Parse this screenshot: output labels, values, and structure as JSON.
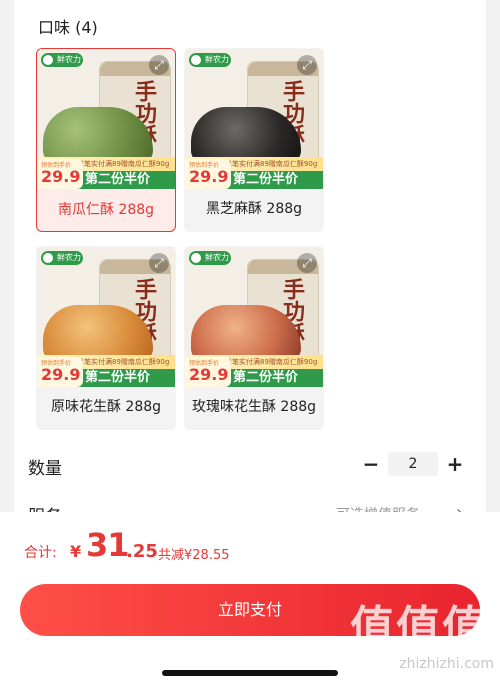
{
  "flavor": {
    "title": "口味 (4)",
    "items": [
      {
        "label": "南瓜仁酥 288g",
        "selected": true,
        "can_text": "手功酥",
        "price": "29.9",
        "price_cap": "预估到手价",
        "promo_top": "单笔实付满89赠南瓜仁酥90g",
        "promo": "第二份半价",
        "logo": "鲜农力"
      },
      {
        "label": "黑芝麻酥 288g",
        "selected": false,
        "can_text": "手功酥",
        "price": "29.9",
        "price_cap": "预估到手价",
        "promo_top": "单笔实付满89赠南瓜仁酥90g",
        "promo": "第二份半价",
        "logo": "鲜农力"
      },
      {
        "label": "原味花生酥 288g",
        "selected": false,
        "can_text": "手功酥",
        "price": "29.9",
        "price_cap": "预估到手价",
        "promo_top": "单笔实付满89赠南瓜仁酥90g",
        "promo": "第二份半价",
        "logo": "鲜农力"
      },
      {
        "label": "玫瑰味花生酥 288g",
        "selected": false,
        "can_text": "手功酥",
        "price": "29.9",
        "price_cap": "预估到手价",
        "promo_top": "单笔实付满89赠南瓜仁酥90g",
        "promo": "第二份半价",
        "logo": "鲜农力"
      }
    ]
  },
  "quantity": {
    "label": "数量",
    "value": "2",
    "minus": "−",
    "plus": "+"
  },
  "service": {
    "label": "服务",
    "value": "可选增值服务",
    "arrow": "›"
  },
  "summary": {
    "total_label": "合计:",
    "currency": "¥",
    "total_int": "31",
    "total_dec": ".25",
    "savings": "共减¥28.55"
  },
  "pay_button": {
    "label": "立即支付"
  },
  "watermark": {
    "glyphs": "值值值",
    "site": "zhizhizhi.com"
  },
  "icons": {
    "zoom": "expand-icon"
  },
  "colors": {
    "accent": "#e53935",
    "promo_green": "#2e9a4a",
    "button_gradient_start": "#ff4f48",
    "button_gradient_end": "#e8242e"
  }
}
